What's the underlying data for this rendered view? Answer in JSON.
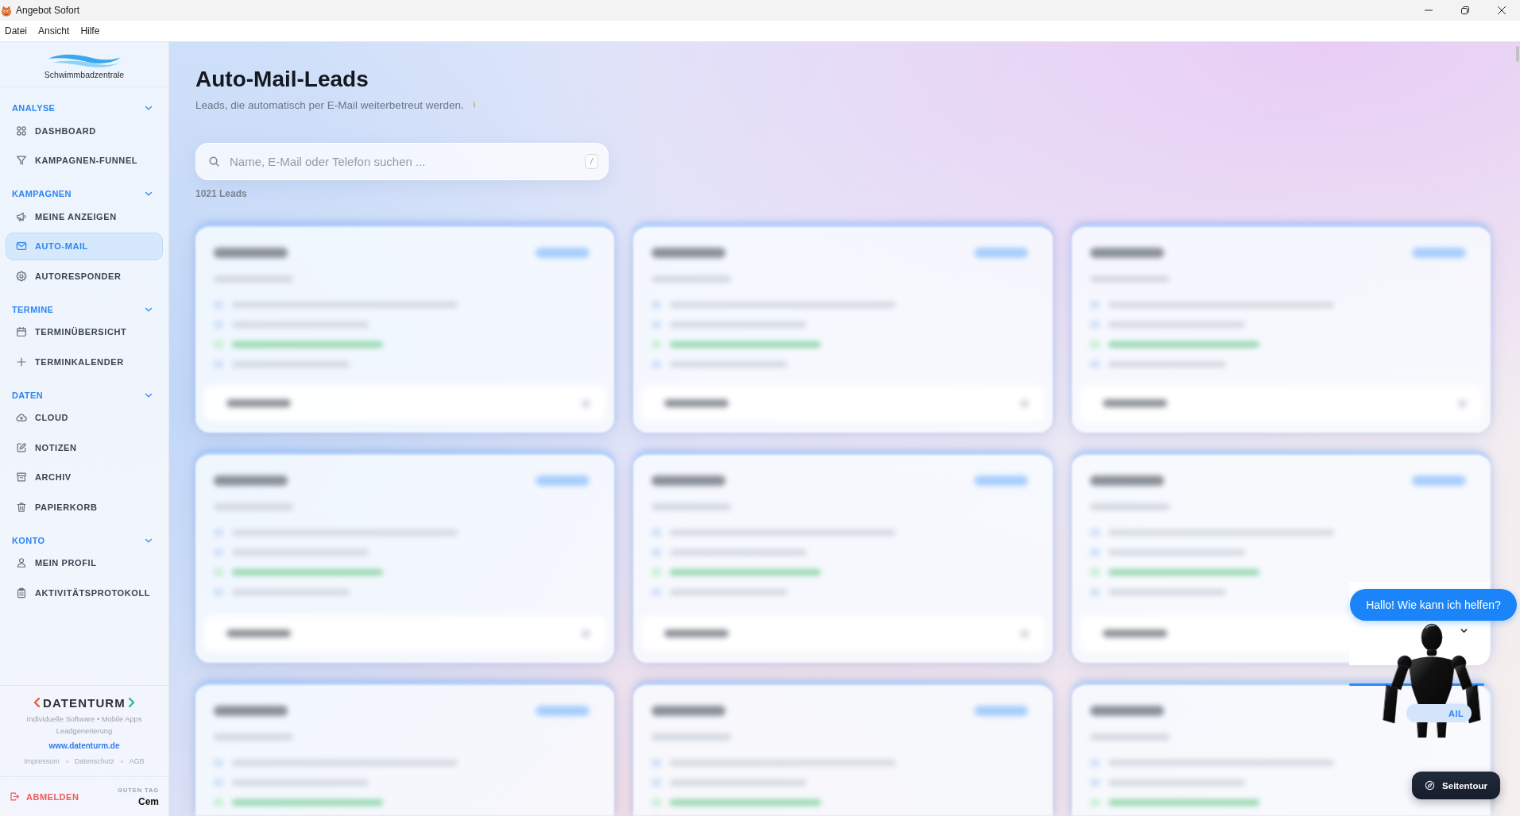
{
  "window": {
    "title": "Angebot Sofort"
  },
  "menu_bar": [
    "Datei",
    "Ansicht",
    "Hilfe"
  ],
  "sidebar": {
    "brand": "Schwimmbadzentrale",
    "sections": [
      {
        "title": "ANALYSE",
        "expanded": true,
        "items": [
          {
            "label": "DASHBOARD",
            "selected": false
          },
          {
            "label": "KAMPAGNEN-FUNNEL",
            "selected": false
          }
        ]
      },
      {
        "title": "KAMPAGNEN",
        "expanded": true,
        "items": [
          {
            "label": "MEINE ANZEIGEN",
            "selected": false
          },
          {
            "label": "AUTO-MAIL",
            "selected": true
          },
          {
            "label": "AUTORESPONDER",
            "selected": false
          }
        ]
      },
      {
        "title": "TERMINE",
        "expanded": true,
        "items": [
          {
            "label": "TERMINÜBERSICHT",
            "selected": false
          },
          {
            "label": "TERMINKALENDER",
            "selected": false
          }
        ]
      },
      {
        "title": "DATEN",
        "expanded": true,
        "items": [
          {
            "label": "CLOUD",
            "selected": false
          },
          {
            "label": "NOTIZEN",
            "selected": false
          },
          {
            "label": "ARCHIV",
            "selected": false
          },
          {
            "label": "PAPIERKORB",
            "selected": false
          }
        ]
      },
      {
        "title": "KONTO",
        "expanded": true,
        "items": [
          {
            "label": "MEIN PROFIL",
            "selected": false
          },
          {
            "label": "AKTIVITÄTSPROTOKOLL",
            "selected": false
          }
        ]
      }
    ],
    "footer": {
      "company": "DATENTURM",
      "services": "Individuelle Software • Mobile Apps",
      "services_2": "Leadgenerierung",
      "website": "www.datenturm.de",
      "links": [
        "Impressum",
        "Datenschutz",
        "AGB"
      ]
    },
    "logout": "ABMELDEN",
    "greeting": "GUTEN TAG",
    "user_name": "Cem"
  },
  "main": {
    "title": "Auto-Mail-Leads",
    "subtitle": "Leads, die automatisch per E-Mail weiterbetreut werden.",
    "search": {
      "placeholder": "Name, E-Mail oder Telefon suchen ...",
      "shortcut": "/"
    },
    "lead_count": "1021 Leads",
    "lead_cards": [
      {
        "blurred": true
      },
      {
        "blurred": true
      },
      {
        "blurred": true
      },
      {
        "blurred": true
      },
      {
        "blurred": true
      },
      {
        "blurred": true
      },
      {
        "blurred": true
      },
      {
        "blurred": true
      },
      {
        "blurred": true
      }
    ]
  },
  "chat": {
    "greeting": "Hallo! Wie kann ich helfen?",
    "tag": "AIL"
  },
  "tour_button": "Seitentour"
}
